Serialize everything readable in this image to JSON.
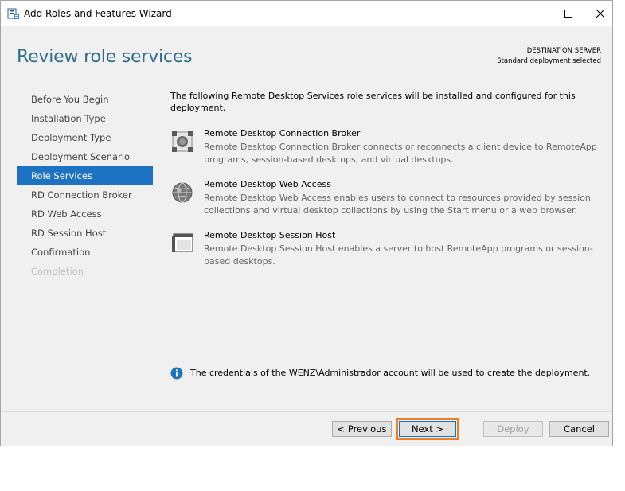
{
  "window": {
    "title": "Add Roles and Features Wizard"
  },
  "header": {
    "page_title": "Review role services",
    "destination_label": "DESTINATION SERVER",
    "destination_value": "Standard deployment selected"
  },
  "sidebar": {
    "items": [
      {
        "label": "Before You Begin",
        "state": "normal"
      },
      {
        "label": "Installation Type",
        "state": "normal"
      },
      {
        "label": "Deployment Type",
        "state": "normal"
      },
      {
        "label": "Deployment Scenario",
        "state": "normal"
      },
      {
        "label": "Role Services",
        "state": "active"
      },
      {
        "label": "RD Connection Broker",
        "state": "normal"
      },
      {
        "label": "RD Web Access",
        "state": "normal"
      },
      {
        "label": "RD Session Host",
        "state": "normal"
      },
      {
        "label": "Confirmation",
        "state": "normal"
      },
      {
        "label": "Completion",
        "state": "disabled"
      }
    ]
  },
  "main": {
    "intro": "The following Remote Desktop Services role services will be installed and configured for this deployment.",
    "services": [
      {
        "name": "Remote Desktop Connection Broker",
        "description": "Remote Desktop Connection Broker connects or reconnects a client device to RemoteApp programs, session-based desktops, and virtual desktops.",
        "icon": "connection-broker-icon"
      },
      {
        "name": "Remote Desktop Web Access",
        "description": "Remote Desktop Web Access enables users to connect to resources provided by session collections and virtual desktop collections by using the Start menu or a web browser.",
        "icon": "web-access-icon"
      },
      {
        "name": "Remote Desktop Session Host",
        "description": "Remote Desktop Session Host enables a server to host RemoteApp programs or session-based desktops.",
        "icon": "session-host-icon"
      }
    ],
    "info_text": "The credentials of the WENZ\\Administrador account will be used to create the deployment."
  },
  "footer": {
    "previous_label": "< Previous",
    "next_label": "Next >",
    "deploy_label": "Deploy",
    "cancel_label": "Cancel"
  },
  "colors": {
    "accent": "#1e72c2",
    "title": "#2e6e8c",
    "highlight": "#f07e1e"
  }
}
